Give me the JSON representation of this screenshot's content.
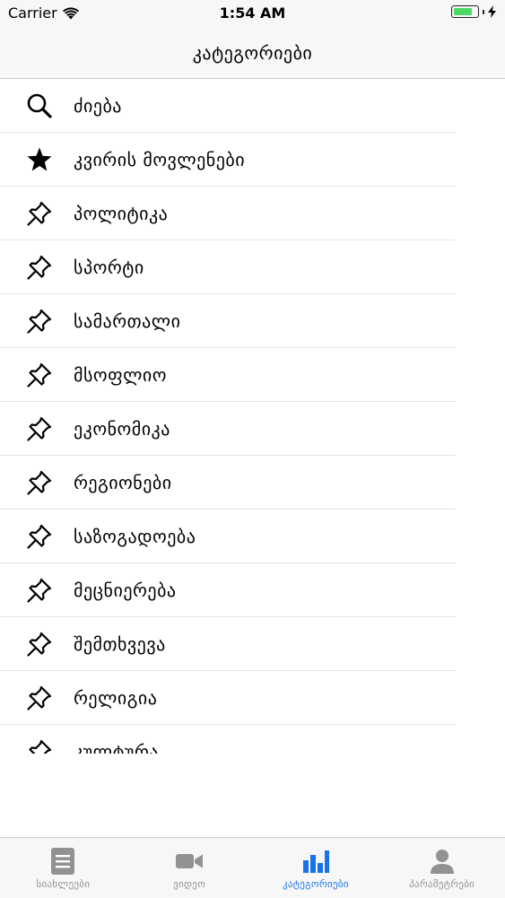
{
  "status_bar": {
    "carrier": "Carrier",
    "time": "1:54 AM",
    "battery_level": 0.85,
    "battery_color": "#4cd964"
  },
  "nav": {
    "title": "კატეგორიები"
  },
  "list": {
    "items": [
      {
        "label": "ძიება",
        "icon": "search-icon"
      },
      {
        "label": "კვირის მოვლენები",
        "icon": "star-icon"
      },
      {
        "label": "პოლიტიკა",
        "icon": "pin-icon"
      },
      {
        "label": "სპორტი",
        "icon": "pin-icon"
      },
      {
        "label": "სამართალი",
        "icon": "pin-icon"
      },
      {
        "label": "მსოფლიო",
        "icon": "pin-icon"
      },
      {
        "label": "ეკონომიკა",
        "icon": "pin-icon"
      },
      {
        "label": "რეგიონები",
        "icon": "pin-icon"
      },
      {
        "label": "საზოგადოება",
        "icon": "pin-icon"
      },
      {
        "label": "მეცნიერება",
        "icon": "pin-icon"
      },
      {
        "label": "შემთხვევა",
        "icon": "pin-icon"
      },
      {
        "label": "რელიგია",
        "icon": "pin-icon"
      },
      {
        "label": "კულტურა",
        "icon": "pin-icon"
      }
    ]
  },
  "tabs": {
    "active_color": "#1a73e8",
    "inactive_color": "#929292",
    "items": [
      {
        "label": "სიახლეები",
        "icon": "news-icon",
        "active": false
      },
      {
        "label": "ვიდეო",
        "icon": "video-camera-icon",
        "active": false
      },
      {
        "label": "კატეგორიები",
        "icon": "bar-chart-icon",
        "active": true
      },
      {
        "label": "პარამეტრები",
        "icon": "user-icon",
        "active": false
      }
    ]
  }
}
